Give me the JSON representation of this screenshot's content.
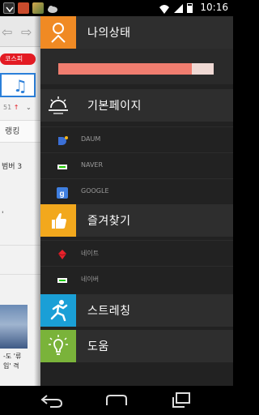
{
  "status_bar": {
    "time": "10:16",
    "icons": [
      "notification-icon",
      "app-icon",
      "photo-icon",
      "cloud-icon",
      "wifi-icon",
      "signal-icon",
      "battery-icon"
    ]
  },
  "browser": {
    "kospi_label": "코스피",
    "rank_fragment": "51",
    "tab_label": "랭킹",
    "news_fragment_1": "범버 3",
    "news_fragment_2": "'",
    "caption_1": "-도 '류",
    "caption_2": "입' 격"
  },
  "drawer": {
    "my_status": {
      "label": "나의상태",
      "progress_percent": 86,
      "accent": "#f08a24",
      "bar_color": "#f07d6f",
      "track_color": "#efd9d4"
    },
    "default_page": {
      "label": "기본페이지",
      "icon": "sunrise-icon"
    },
    "default_items": [
      {
        "label": "DAUM",
        "icon": "daum-icon"
      },
      {
        "label": "NAVER",
        "icon": "naver-icon"
      },
      {
        "label": "GOOGLE",
        "icon": "google-icon"
      }
    ],
    "favorites": {
      "label": "즐겨찾기",
      "accent": "#f2a81d",
      "icon": "thumbs-up-icon"
    },
    "favorite_items": [
      {
        "label": "네이트",
        "icon": "nate-icon"
      },
      {
        "label": "네이버",
        "icon": "naver-icon"
      }
    ],
    "stretching": {
      "label": "스트레칭",
      "accent": "#1a9fd6",
      "icon": "running-person-icon"
    },
    "help": {
      "label": "도움",
      "accent": "#7ab33a",
      "icon": "lightbulb-icon"
    }
  },
  "navbar": {
    "buttons": [
      "back-icon",
      "home-icon",
      "recent-apps-icon"
    ]
  }
}
